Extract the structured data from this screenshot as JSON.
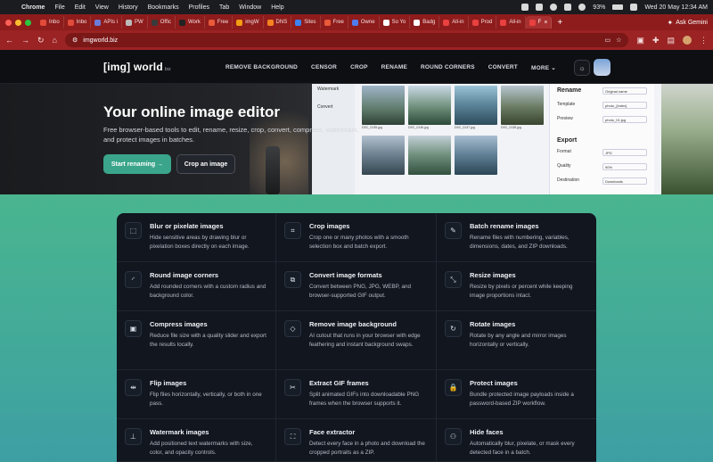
{
  "menubar": {
    "app": "Chrome",
    "items": [
      "File",
      "Edit",
      "View",
      "History",
      "Bookmarks",
      "Profiles",
      "Tab",
      "Window",
      "Help"
    ],
    "battery": "93%",
    "datetime": "Wed 20 May  12:34 AM"
  },
  "tabs": [
    {
      "label": "Inbo",
      "color": "#e14b3b"
    },
    {
      "label": "Inbo",
      "color": "#e14b3b"
    },
    {
      "label": "APIs i",
      "color": "#6c7bd9"
    },
    {
      "label": "PW",
      "color": "#bbbbbb"
    },
    {
      "label": "Offic",
      "color": "#3a3a3a"
    },
    {
      "label": "Work",
      "color": "#222222"
    },
    {
      "label": "Free",
      "color": "#e85a3a"
    },
    {
      "label": "imgW",
      "color": "#f39c12"
    },
    {
      "label": "DNS",
      "color": "#f58220"
    },
    {
      "label": "Sites",
      "color": "#3b82f6"
    },
    {
      "label": "Free",
      "color": "#e85a3a"
    },
    {
      "label": "Owne",
      "color": "#4f7cf0"
    },
    {
      "label": "So Yo",
      "color": "#ffffff"
    },
    {
      "label": "Badg",
      "color": "#ffffff"
    },
    {
      "label": "All-in",
      "color": "#e94040"
    },
    {
      "label": "Prod",
      "color": "#e94040"
    },
    {
      "label": "All-in",
      "color": "#e94040"
    },
    {
      "label": "F",
      "color": "#e94040"
    }
  ],
  "browser": {
    "url": "imgworld.biz",
    "ask_gemini": "Ask Gemini"
  },
  "site": {
    "logo": "[img] world",
    "logo_suffix": "biz",
    "nav": [
      "REMOVE BACKGROUND",
      "CENSOR",
      "CROP",
      "RENAME",
      "ROUND CORNERS",
      "CONVERT",
      "MORE"
    ]
  },
  "hero": {
    "title": "Your online image editor",
    "subtitle": "Free browser-based tools to edit, rename, resize, crop, convert, compress, watermark, and protect images in batches.",
    "primary_cta": "Start renaming  →",
    "secondary_cta": "Crop an image",
    "mock": {
      "side": [
        "Watermark",
        "Convert"
      ],
      "panel_title": "Rename",
      "panel_sort": "Original name",
      "template_label": "Template",
      "template_value": "photo_{index}",
      "preview_label": "Preview",
      "preview_value": "photo_01.jpg",
      "export_title": "Export",
      "format_label": "Format",
      "format_value": "JPG",
      "quality_label": "Quality",
      "quality_value": "90%",
      "destination_label": "Destination",
      "destination_value": "Downloads",
      "captions": [
        "DSC_0135.jpg",
        "DSC_0136.jpg",
        "DSC_0137.jpg",
        "DSC_0138.jpg"
      ]
    }
  },
  "features": [
    {
      "title": "Blur or pixelate images",
      "desc": "Hide sensitive areas by drawing blur or pixelation boxes directly on each image.",
      "icon": "blur-icon"
    },
    {
      "title": "Crop images",
      "desc": "Crop one or many photos with a smooth selection box and batch export.",
      "icon": "crop-icon"
    },
    {
      "title": "Batch rename images",
      "desc": "Rename files with numbering, variables, dimensions, dates, and ZIP downloads.",
      "icon": "rename-icon"
    },
    {
      "title": "Round image corners",
      "desc": "Add rounded corners with a custom radius and background color.",
      "icon": "round-corners-icon"
    },
    {
      "title": "Convert image formats",
      "desc": "Convert between PNG, JPG, WEBP, and browser-supported GIF output.",
      "icon": "convert-icon"
    },
    {
      "title": "Resize images",
      "desc": "Resize by pixels or percent while keeping image proportions intact.",
      "icon": "resize-icon"
    },
    {
      "title": "Compress images",
      "desc": "Reduce file size with a quality slider and export the results locally.",
      "icon": "compress-icon"
    },
    {
      "title": "Remove image background",
      "desc": "AI cutout that runs in your browser with edge feathering and instant background swaps.",
      "icon": "eraser-icon"
    },
    {
      "title": "Rotate images",
      "desc": "Rotate by any angle and mirror images horizontally or vertically.",
      "icon": "rotate-icon"
    },
    {
      "title": "Flip images",
      "desc": "Flip files horizontally, vertically, or both in one pass.",
      "icon": "flip-icon"
    },
    {
      "title": "Extract GIF frames",
      "desc": "Split animated GIFs into downloadable PNG frames when the browser supports it.",
      "icon": "scissors-icon"
    },
    {
      "title": "Protect images",
      "desc": "Bundle protected image payloads inside a password-based ZIP workflow.",
      "icon": "lock-icon"
    },
    {
      "title": "Watermark images",
      "desc": "Add positioned text watermarks with size, color, and opacity controls.",
      "icon": "stamp-icon"
    },
    {
      "title": "Face extractor",
      "desc": "Detect every face in a photo and download the cropped portraits as a ZIP.",
      "icon": "face-scan-icon"
    },
    {
      "title": "Hide faces",
      "desc": "Automatically blur, pixelate, or mask every detected face in a batch.",
      "icon": "user-hide-icon"
    }
  ]
}
